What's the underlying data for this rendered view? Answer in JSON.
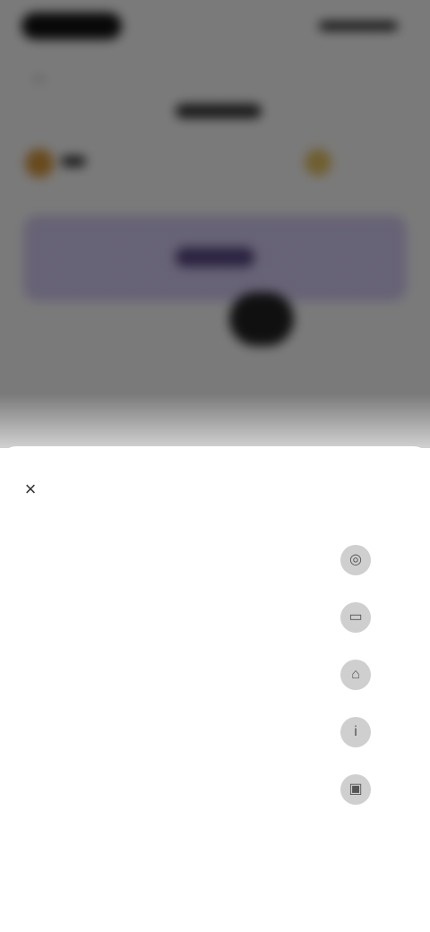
{
  "status_bar": {
    "time": "",
    "indicators": ""
  },
  "background": {
    "title": "",
    "accent_color": "#d8cef6",
    "currency_left": "",
    "currency_right": ""
  },
  "sheet": {
    "title": "",
    "close_icon": "close-icon",
    "options": [
      {
        "label": "",
        "icon": "coin-icon"
      },
      {
        "label": "",
        "icon": "card-icon"
      },
      {
        "label": "",
        "icon": "bank-icon"
      },
      {
        "label": "",
        "icon": "info-icon"
      },
      {
        "label": "",
        "icon": "wallet-icon"
      }
    ]
  }
}
